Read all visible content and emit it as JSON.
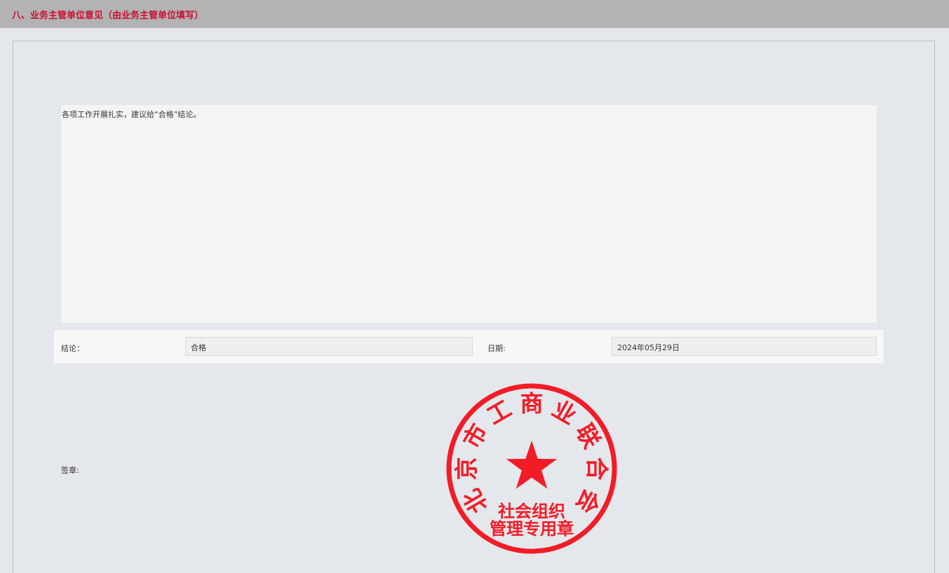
{
  "section": {
    "title": "八、业务主管单位意见（由业务主管单位填写）"
  },
  "opinion": {
    "text": "各项工作开展扎实，建议给“合格”结论。"
  },
  "conclusion": {
    "label": "结论：",
    "value": "合格"
  },
  "date": {
    "label": "日期:",
    "value": "2024年05月29日"
  },
  "signature": {
    "label": "签章:"
  },
  "seal": {
    "organization": "北京市工商业联合会",
    "line1": "社会组织",
    "line2": "管理专用章",
    "color": "#f21c26",
    "icon": "star-icon"
  },
  "colors": {
    "header_bg": "#b3b3b3",
    "title_text": "#c8102e",
    "page_bg": "#e4e7ec"
  }
}
